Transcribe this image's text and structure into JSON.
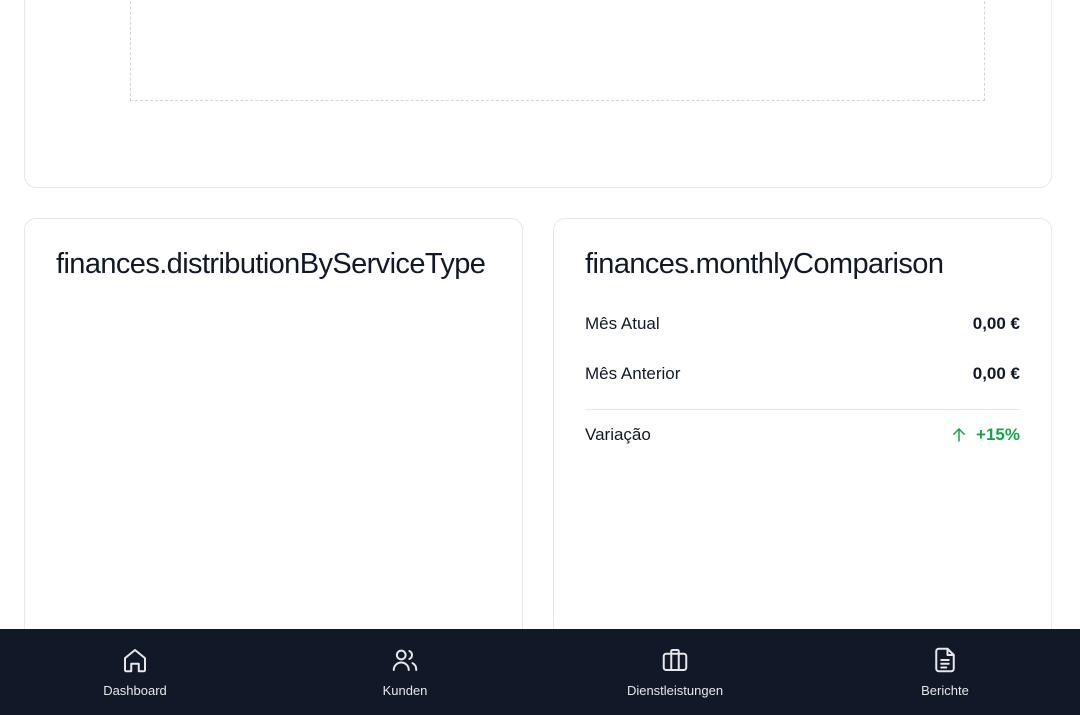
{
  "top_section": {},
  "distribution_card": {
    "title": "finances.distributionByServiceType"
  },
  "comparison_card": {
    "title": "finances.monthlyComparison",
    "current_month_label": "Mês Atual",
    "current_month_value": "0,00 €",
    "previous_month_label": "Mês Anterior",
    "previous_month_value": "0,00 €",
    "variation_label": "Variação",
    "variation_value": "+15%",
    "variation_icon": "arrow-up-icon",
    "variation_color": "#16a34a"
  },
  "bottom_nav": {
    "background": "#111827",
    "items": [
      {
        "label": "Dashboard",
        "icon": "home-icon"
      },
      {
        "label": "Kunden",
        "icon": "users-icon"
      },
      {
        "label": "Dienstleistungen",
        "icon": "briefcase-icon"
      },
      {
        "label": "Berichte",
        "icon": "file-text-icon"
      }
    ]
  }
}
